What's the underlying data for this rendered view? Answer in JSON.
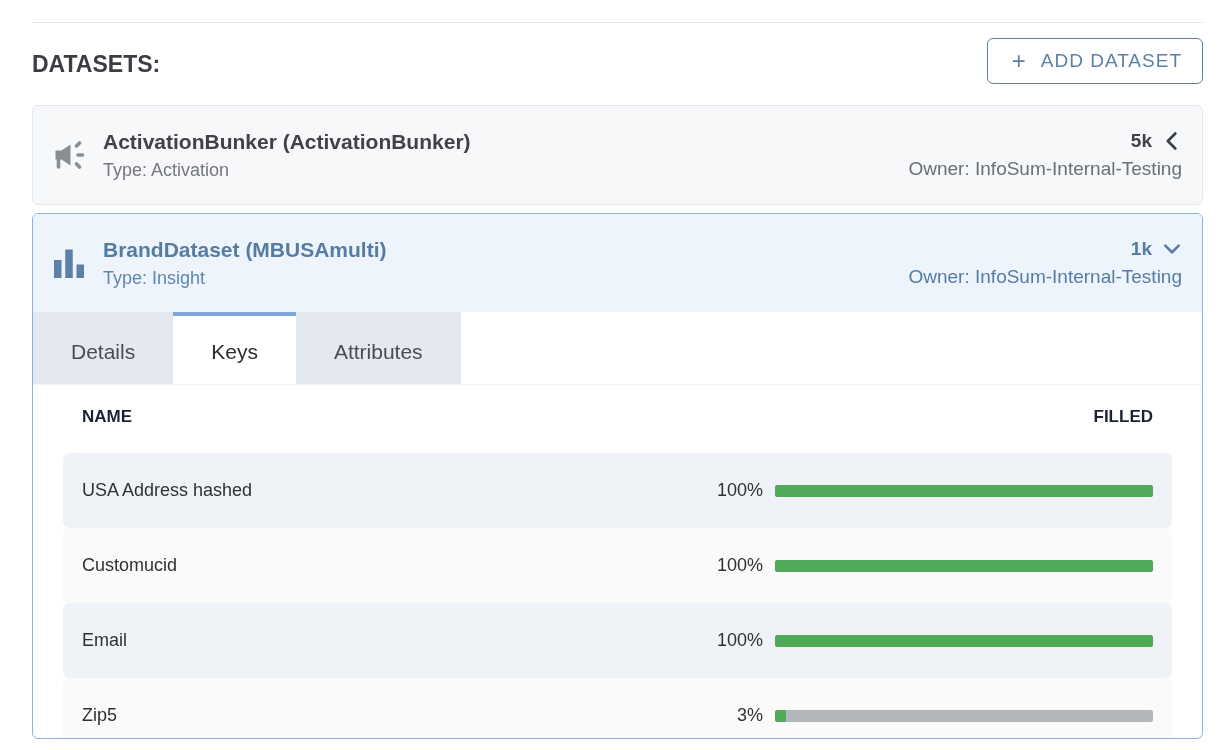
{
  "heading": "DATASETS:",
  "add_button": {
    "icon": "+",
    "label": "ADD DATASET"
  },
  "datasets": [
    {
      "kind": "activation",
      "title": "ActivationBunker (ActivationBunker)",
      "type": "Type: Activation",
      "count": "5k",
      "owner": "Owner: InfoSum-Internal-Testing",
      "expanded": false
    },
    {
      "kind": "insight",
      "title": "BrandDataset (MBUSAmulti)",
      "type": "Type: Insight",
      "count": "1k",
      "owner": "Owner: InfoSum-Internal-Testing",
      "expanded": true,
      "tabs": [
        {
          "label": "Details",
          "selected": false
        },
        {
          "label": "Keys",
          "selected": true
        },
        {
          "label": "Attributes",
          "selected": false
        }
      ],
      "table": {
        "columns": [
          "NAME",
          "FILLED"
        ],
        "rows": [
          {
            "name": "USA Address hashed",
            "reading": "100%",
            "level": 1.0
          },
          {
            "name": "Customucid",
            "reading": "100%",
            "level": 1.0
          },
          {
            "name": "Email",
            "reading": "100%",
            "level": 1.0
          },
          {
            "name": "Zip5",
            "reading": "3%",
            "level": 0.03
          }
        ]
      }
    }
  ]
}
